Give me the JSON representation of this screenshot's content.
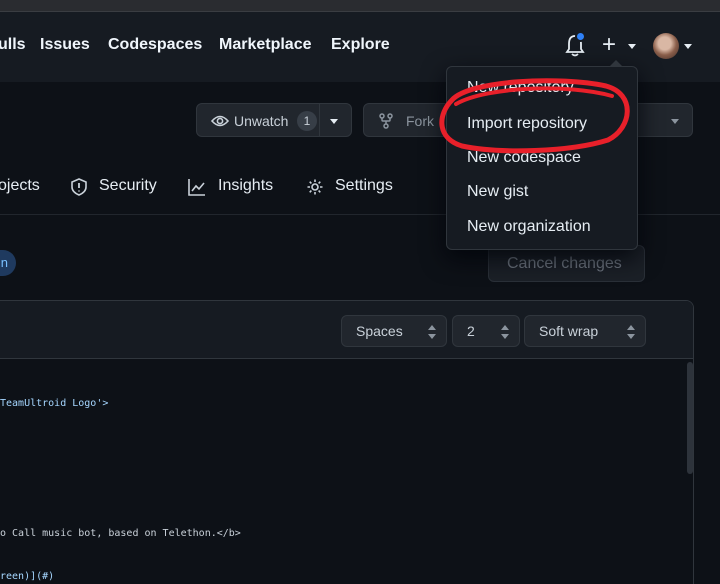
{
  "header": {
    "nav": [
      "ulls",
      "Issues",
      "Codespaces",
      "Marketplace",
      "Explore"
    ]
  },
  "repo_actions": {
    "watch_label": "Unwatch",
    "watch_count": "1",
    "fork_label": "Fork"
  },
  "tabs": [
    "ojects",
    "Security",
    "Insights",
    "Settings"
  ],
  "pill_label": "n",
  "cancel_button": "Cancel changes",
  "editor": {
    "indent_mode": "Spaces",
    "indent_size": "2",
    "wrap_mode": "Soft wrap",
    "lines": [
      "TeamUltroid Logo'>",
      "o Call music bot, based on Telethon.</b>",
      "reen)](#)"
    ]
  },
  "dropdown": {
    "items": [
      "New repository",
      "Import repository",
      "New codespace",
      "New gist",
      "New organization"
    ]
  },
  "colors": {
    "background": "#0d1117",
    "header": "#161b22",
    "accent_blue": "#2f81f7",
    "annotation_red": "#e8202a"
  }
}
